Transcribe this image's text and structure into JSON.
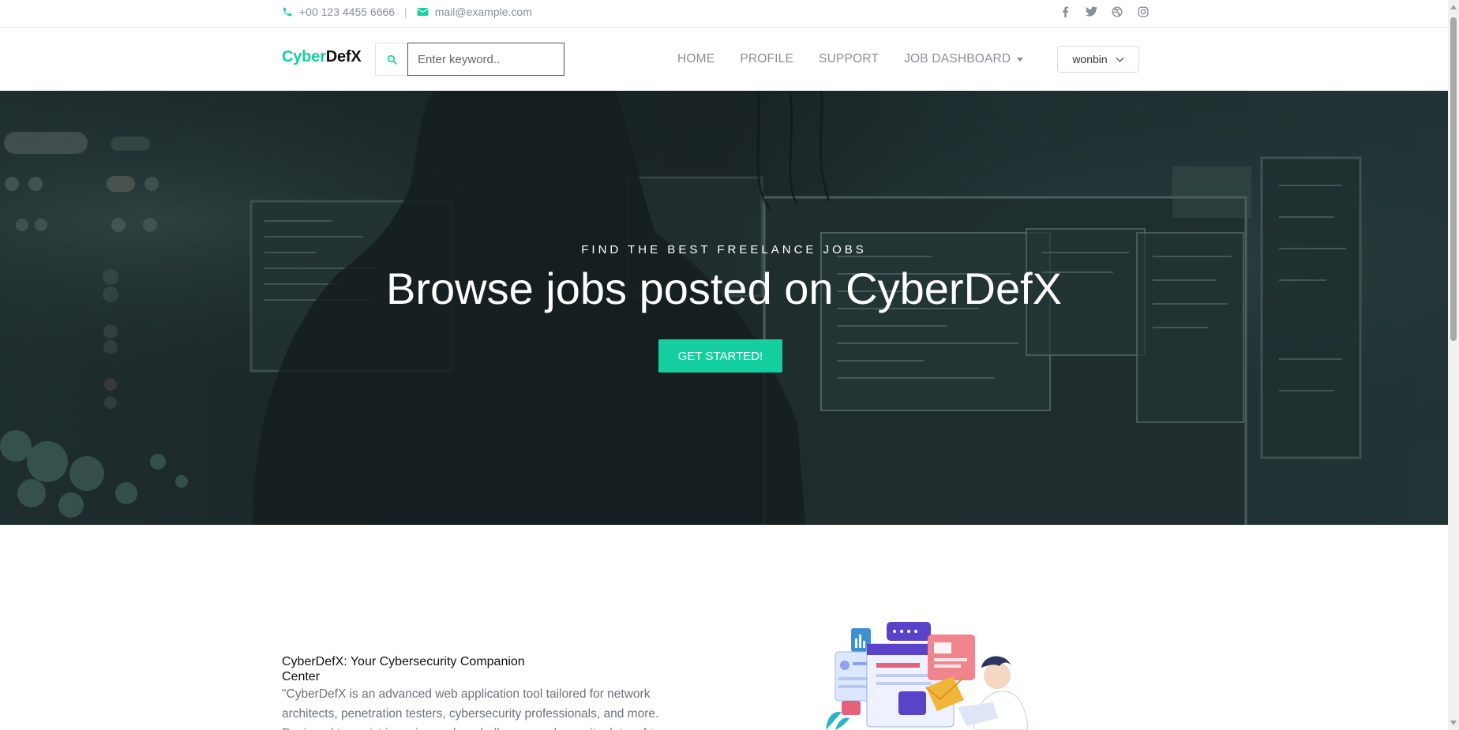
{
  "topbar": {
    "phone": "+00 123 4455 6666",
    "separator": "|",
    "email": "mail@example.com",
    "social_icons": [
      "facebook-icon",
      "twitter-icon",
      "dribbble-icon",
      "instagram-icon"
    ]
  },
  "nav": {
    "brand_part1": "Cyber",
    "brand_part2": "DefX",
    "search_placeholder": "Enter keyword..",
    "links": {
      "home": "HOME",
      "profile": "PROFILE",
      "support": "SUPPORT",
      "job_dashboard": "JOB DASHBOARD"
    },
    "user": "wonbin"
  },
  "hero": {
    "subtitle": "FIND THE BEST FREELANCE JOBS",
    "title": "Browse jobs posted on CyberDefX",
    "cta": "GET STARTED!"
  },
  "about": {
    "title": "CyberDefX: Your Cybersecurity Companion Center",
    "text": "\"CyberDefX is an advanced web application tool tailored for network architects, penetration testers, cybersecurity professionals, and more. Designed to assist in various cyber challenges and security data, of t"
  },
  "colors": {
    "accent": "#14d0a0",
    "muted": "#8a8f95"
  }
}
